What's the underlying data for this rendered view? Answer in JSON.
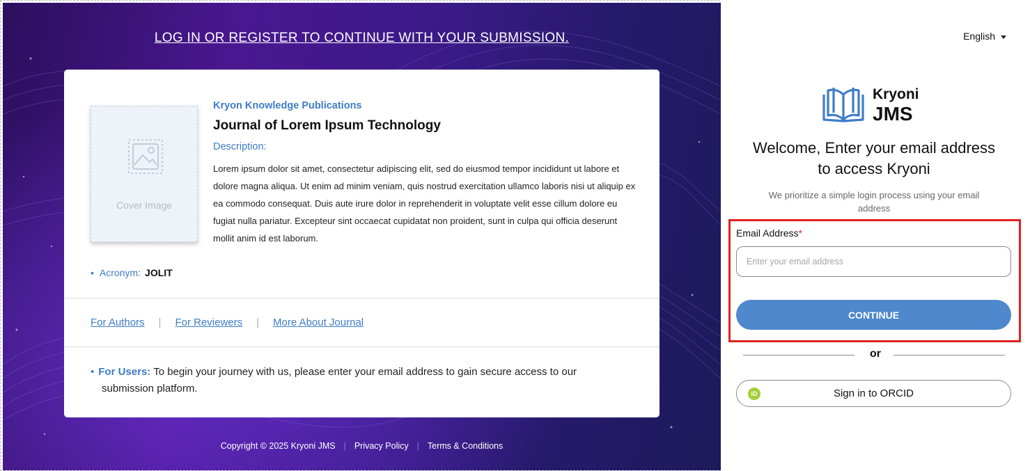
{
  "banner": {
    "title": "LOG IN OR REGISTER TO CONTINUE WITH YOUR SUBMISSION."
  },
  "journal_card": {
    "cover_label": "Cover Image",
    "publisher": "Kryon Knowledge Publications",
    "journal_title": "Journal of Lorem Ipsum Technology",
    "description_label": "Description:",
    "description": "Lorem ipsum dolor sit amet, consectetur adipiscing elit, sed do eiusmod tempor incididunt ut labore et dolore magna aliqua. Ut enim ad minim veniam, quis nostrud exercitation ullamco laboris nisi ut aliquip ex ea commodo consequat. Duis aute irure dolor in reprehenderit in voluptate velit esse cillum dolore eu fugiat nulla pariatur. Excepteur sint occaecat cupidatat non proident, sunt in culpa qui officia deserunt mollit anim id est laborum.",
    "acronym_label": "Acronym:",
    "acronym_value": "JOLIT",
    "links": {
      "authors": "For Authors",
      "reviewers": "For Reviewers",
      "about": "More About Journal"
    },
    "users_label": "For Users:",
    "users_text": "To begin your journey with us, please enter your email address to gain secure access to our",
    "users_text_2": "submission platform."
  },
  "footer": {
    "copyright": "Copyright © 2025 Kryoni JMS",
    "privacy": "Privacy Policy",
    "terms": "Terms & Conditions"
  },
  "login": {
    "language": "English",
    "brand_line1": "Kryoni",
    "brand_line2": "JMS",
    "welcome": "Welcome, Enter your email address to access Kryoni",
    "subtitle": "We prioritize a simple login process using your email address",
    "email_label": "Email Address",
    "email_required_mark": "*",
    "email_placeholder": "Enter your email address",
    "email_value": "",
    "continue_label": "CONTINUE",
    "or_label": "or",
    "orcid_icon_text": "iD",
    "orcid_label": "Sign in to ORCID"
  },
  "colors": {
    "accent_blue": "#3f7cc8",
    "button_blue": "#4f88cc",
    "highlight_red": "#e02020",
    "orcid_green": "#a6ce39",
    "bg_purple": "#4a1790"
  }
}
